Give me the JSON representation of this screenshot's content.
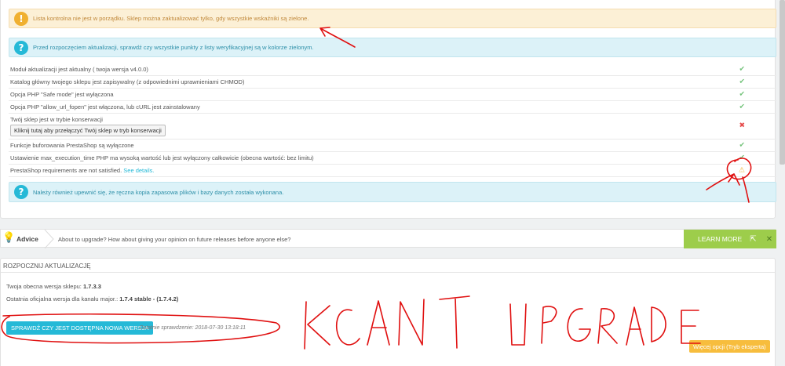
{
  "alerts": {
    "warning": "Lista kontrolna nie jest w porządku. Sklep można zaktualizować tylko, gdy wszystkie wskaźniki są zielone.",
    "info_top": "Przed rozpoczęciem aktualizacji, sprawdź czy wszystkie punkty z listy weryfikacyjnej są w kolorze zielonym.",
    "info_bottom": "Należy również upewnić się, że ręczna kopia zapasowa plików i bazy danych została wykonana."
  },
  "checklist": [
    {
      "text": "Moduł aktualizacji jest aktualny ( twoja wersja v4.0.0)",
      "status": "ok",
      "icon": "check-icon"
    },
    {
      "text": "Katalog główny twojego sklepu jest zapisywalny (z odpowiednimi uprawnieniami CHMOD)",
      "status": "ok",
      "icon": "check-icon"
    },
    {
      "text": "Opcja PHP \"Safe mode\" jest wyłączona",
      "status": "ok",
      "icon": "check-icon"
    },
    {
      "text": "Opcja PHP \"allow_url_fopen\" jest włączona, lub cURL jest zainstalowany",
      "status": "ok",
      "icon": "check-icon"
    },
    {
      "text": "Twój sklep jest w trybie konserwacji",
      "button": "Kliknij tutaj aby przełączyć Twój sklep w tryb konserwacji",
      "status": "bad",
      "icon": "cross-icon"
    },
    {
      "text": "Funkcje buforowania PrestaShop są wyłączone",
      "status": "ok",
      "icon": "check-icon"
    },
    {
      "text": "Ustawienie max_execution_time PHP ma wysoką wartość lub jest wyłączony całkowicie (obecna wartość: bez limitu)",
      "status": "ok",
      "icon": "check-icon"
    },
    {
      "text": "PrestaShop requirements are not satisfied.",
      "link": "See details.",
      "status": "warn",
      "icon": "warning-icon"
    }
  ],
  "advice": {
    "title": "Advice",
    "text": "About to upgrade? How about giving your opinion on future releases before anyone else?",
    "learn_more": "LEARN MORE",
    "close": "✕"
  },
  "upgrade": {
    "section_title": "ROZPOCZNIJ AKTUALIZACJĘ",
    "current_label": "Twoja obecna wersja sklepu:",
    "current_value": "1.7.3.3",
    "latest_label": "Ostatnia oficjalna wersja dla kanału major.:",
    "latest_value": "1.7.4 stable - (1.7.4.2)",
    "check_button": "SPRAWDŹ CZY JEST DOSTĘPNA NOWA WERSJA",
    "last_check": "- Ostatnie sprawdzenie: 2018-07-30 13:18:11",
    "more_options": "Więcej opcji (Tryb eksperta)"
  },
  "annotation": {
    "scrawl": "KCANT UPGRADE"
  },
  "colors": {
    "success": "#72c279",
    "danger": "#e54b4b",
    "warning": "#f0b030",
    "primary": "#25b9d7",
    "advice_green": "#9dcd4b",
    "annotation_red": "#e01010"
  }
}
